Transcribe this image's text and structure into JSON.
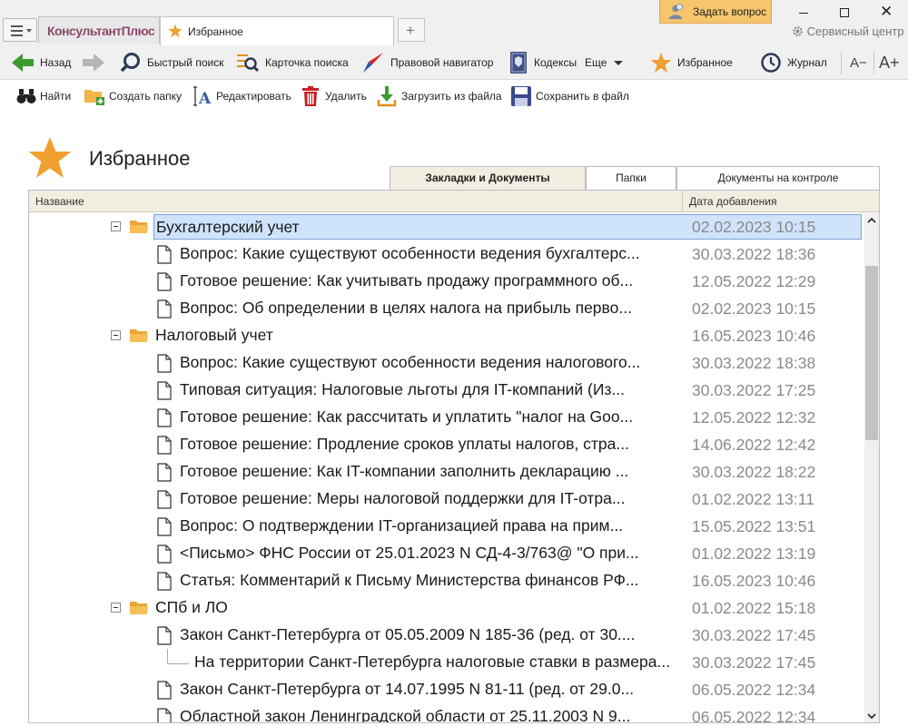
{
  "window": {
    "app_tab_label": "КонсультантПлюс",
    "active_tab_label": "Избранное",
    "new_tab_symbol": "+",
    "ask_question_label": "Задать вопрос",
    "service_center_label": "Сервисный центр",
    "close_symbol": "✕"
  },
  "toolbar": {
    "back": "Назад",
    "quick_search": "Быстрый поиск",
    "search_card": "Карточка поиска",
    "legal_navigator": "Правовой навигатор",
    "codes": "Кодексы",
    "more": "Еще",
    "favorites": "Избранное",
    "journal": "Журнал",
    "font_decrease": "A−",
    "font_increase": "A+"
  },
  "actions": {
    "find": "Найти",
    "create_folder": "Создать папку",
    "edit": "Редактировать",
    "delete": "Удалить",
    "load_from_file": "Загрузить из файла",
    "save_to_file": "Сохранить в файл"
  },
  "page": {
    "title": "Избранное",
    "tabs": [
      {
        "label": "Закладки и Документы",
        "active": true
      },
      {
        "label": "Папки",
        "active": false
      },
      {
        "label": "Документы на контроле",
        "active": false
      }
    ]
  },
  "table": {
    "columns": {
      "name": "Название",
      "date": "Дата добавления"
    },
    "rows": [
      {
        "type": "folder",
        "title": "Бухгалтерский учет",
        "date": "02.02.2023 10:15",
        "selected": true
      },
      {
        "type": "doc",
        "title": "Вопрос: Какие существуют особенности ведения бухгалтерс...",
        "date": "30.03.2022 18:36"
      },
      {
        "type": "doc",
        "title": "Готовое решение: Как учитывать продажу программного об...",
        "date": "12.05.2022 12:29"
      },
      {
        "type": "doc",
        "title": "Вопрос: Об определении в целях налога на прибыль перво...",
        "date": "02.02.2023 10:15"
      },
      {
        "type": "folder",
        "title": "Налоговый учет",
        "date": "16.05.2023 10:46"
      },
      {
        "type": "doc",
        "title": "Вопрос: Какие существуют особенности ведения налогового...",
        "date": "30.03.2022 18:38"
      },
      {
        "type": "doc",
        "title": "Типовая ситуация: Налоговые льготы для IT-компаний (Из...",
        "date": "30.03.2022 17:25"
      },
      {
        "type": "doc",
        "title": "Готовое решение: Как рассчитать и уплатить \"налог на Goo...",
        "date": "12.05.2022 12:32"
      },
      {
        "type": "doc",
        "title": "Готовое решение: Продление сроков уплаты налогов, стра...",
        "date": "14.06.2022 12:42"
      },
      {
        "type": "doc",
        "title": "Готовое решение: Как IT-компании заполнить декларацию ...",
        "date": "30.03.2022 18:22"
      },
      {
        "type": "doc",
        "title": "Готовое решение: Меры налоговой поддержки для IT-отра...",
        "date": "01.02.2022 13:11"
      },
      {
        "type": "doc",
        "title": "Вопрос: О подтверждении IT-организацией права на прим...",
        "date": "15.05.2022 13:51"
      },
      {
        "type": "doc",
        "title": "<Письмо> ФНС России от 25.01.2023 N СД-4-3/763@ \"О при...",
        "date": "01.02.2022 13:19"
      },
      {
        "type": "doc",
        "title": "Статья: Комментарий к Письму Министерства финансов РФ...",
        "date": "16.05.2023 10:46"
      },
      {
        "type": "folder",
        "title": "СПб и ЛО",
        "date": "01.02.2022 15:18"
      },
      {
        "type": "doc",
        "title": "Закон Санкт-Петербурга от 05.05.2009 N 185-36 (ред. от 30....",
        "date": "30.03.2022 17:45"
      },
      {
        "type": "bookmark",
        "title": "На территории Санкт-Петербурга налоговые ставки в размера...",
        "date": "30.03.2022 17:45"
      },
      {
        "type": "doc",
        "title": "Закон Санкт-Петербурга от 14.07.1995 N 81-11 (ред. от 29.0...",
        "date": "06.05.2022 12:34"
      },
      {
        "type": "doc",
        "title": "Областной закон Ленинградской области от 25.11.2003 N 9...",
        "date": "06.05.2022 12:34"
      }
    ]
  },
  "colors": {
    "star": "#f0a030",
    "selection": "#cfe3fb",
    "header_bg": "#f1ede1",
    "date_text": "#8a8a8a",
    "ask_button": "#f6c56c"
  },
  "icons": {
    "back": "arrow-left-green-icon",
    "forward": "arrow-right-gray-icon",
    "quick_search": "magnifier-icon",
    "search_card": "search-card-icon",
    "legal_navigator": "compass-icon",
    "codes": "codex-book-icon",
    "favorites": "star-icon",
    "journal": "clock-icon"
  }
}
